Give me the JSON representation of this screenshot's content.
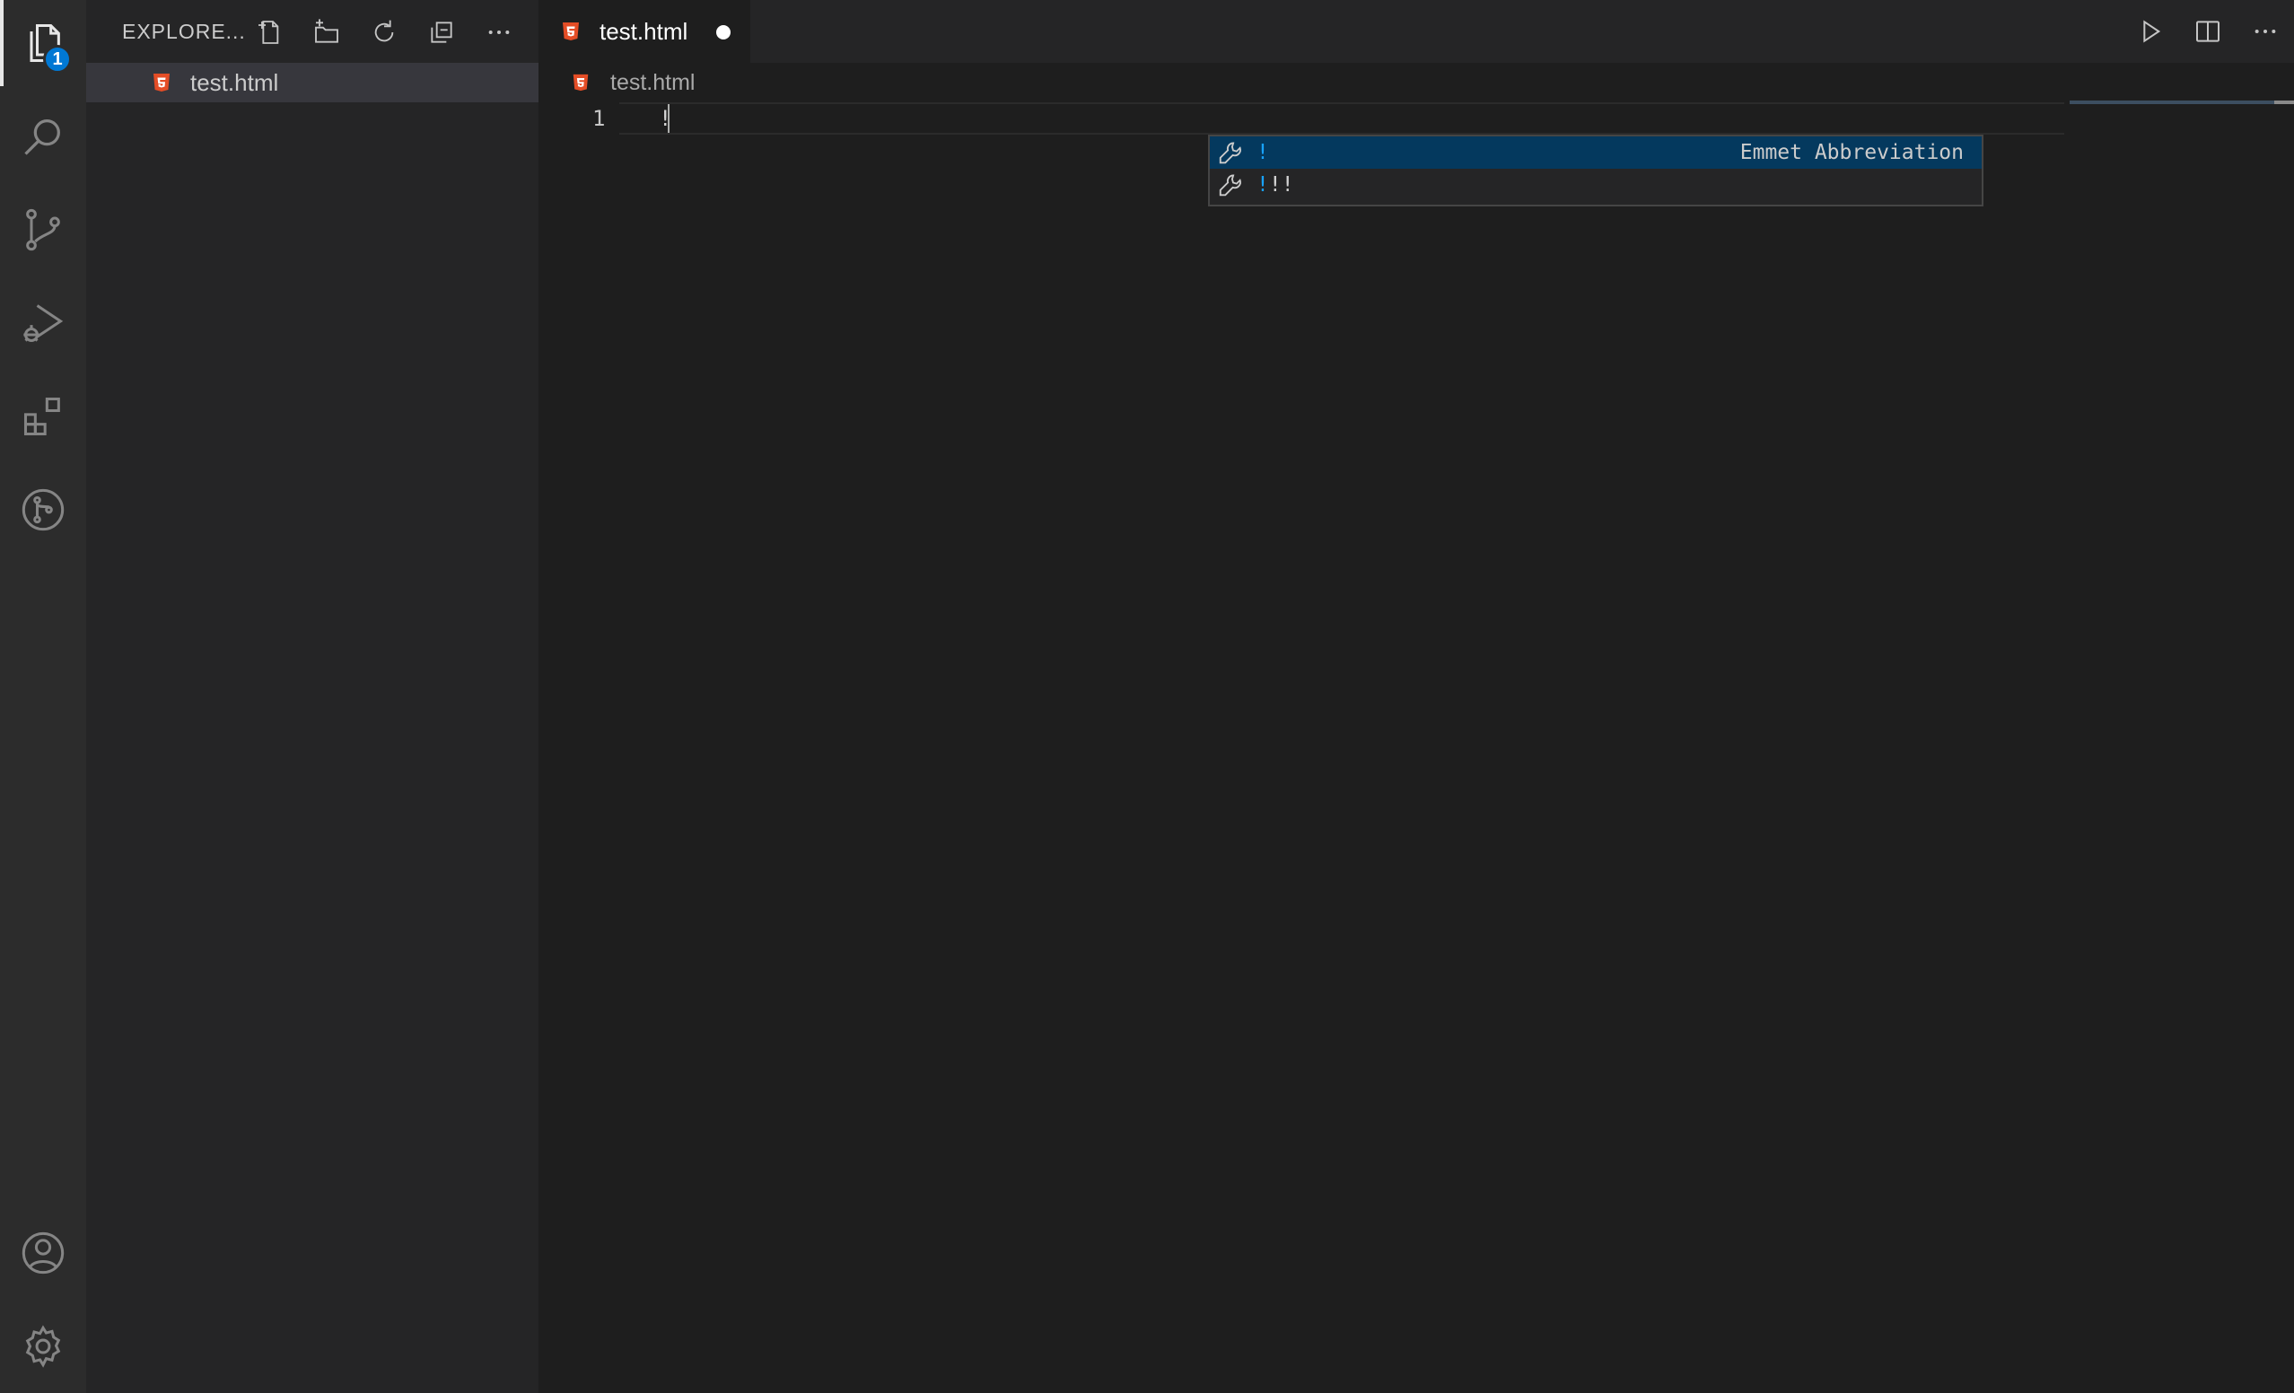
{
  "activity_bar": {
    "explorer_badge": "1",
    "items": [
      "files-icon",
      "search-icon",
      "source-control-icon",
      "run-debug-icon",
      "extensions-icon",
      "git-graph-icon"
    ],
    "bottom_items": [
      "account-icon",
      "settings-gear-icon"
    ]
  },
  "sidebar": {
    "title": "EXPLORE...",
    "actions": [
      "new-file-icon",
      "new-folder-icon",
      "refresh-icon",
      "collapse-all-icon",
      "more-actions-icon"
    ],
    "files": [
      {
        "name": "test.html",
        "icon": "html5-icon"
      }
    ]
  },
  "editor": {
    "tab": {
      "label": "test.html",
      "dirty": true
    },
    "actions": [
      "run-icon",
      "split-editor-icon",
      "more-actions-icon"
    ],
    "breadcrumb": "test.html",
    "lines": [
      {
        "number": "1",
        "text": "!"
      }
    ]
  },
  "suggest": {
    "items": [
      {
        "highlight": "!",
        "rest": "",
        "detail": "Emmet Abbreviation",
        "selected": true
      },
      {
        "highlight": "!",
        "rest": "!!",
        "detail": "",
        "selected": false
      }
    ]
  },
  "colors": {
    "html_icon": "#e44d26",
    "selection": "#04395e",
    "match_highlight": "#18a3ff",
    "badge": "#0078d4"
  }
}
